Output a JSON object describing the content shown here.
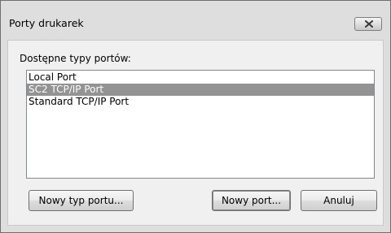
{
  "window": {
    "title": "Porty drukarek"
  },
  "content": {
    "label": "Dostępne typy portów:",
    "port_types": [
      {
        "label": "Local Port",
        "selected": false
      },
      {
        "label": "SC2 TCP/IP Port",
        "selected": true
      },
      {
        "label": "Standard TCP/IP Port",
        "selected": false
      }
    ]
  },
  "buttons": {
    "new_port_type": "Nowy typ portu...",
    "new_port": "Nowy port...",
    "cancel": "Anuluj"
  }
}
